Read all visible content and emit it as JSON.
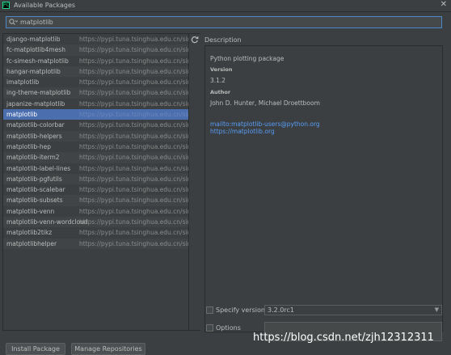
{
  "window": {
    "title": "Available Packages",
    "close_glyph": "✕",
    "app_icon_text": "PC"
  },
  "search": {
    "value": "matplotlib",
    "placeholder": ""
  },
  "packages": [
    {
      "name": "django-matplotlib",
      "url": "https://pypi.tuna.tsinghua.edu.cn/simple/"
    },
    {
      "name": "fc-matplotlib4mesh",
      "url": "https://pypi.tuna.tsinghua.edu.cn/simple/"
    },
    {
      "name": "fc-simesh-matplotlib",
      "url": "https://pypi.tuna.tsinghua.edu.cn/simple/"
    },
    {
      "name": "hangar-matplotlib",
      "url": "https://pypi.tuna.tsinghua.edu.cn/simple/"
    },
    {
      "name": "imatplotlib",
      "url": "https://pypi.tuna.tsinghua.edu.cn/simple/"
    },
    {
      "name": "ing-theme-matplotlib",
      "url": "https://pypi.tuna.tsinghua.edu.cn/simple/"
    },
    {
      "name": "japanize-matplotlib",
      "url": "https://pypi.tuna.tsinghua.edu.cn/simple/"
    },
    {
      "name": "matplotlib",
      "url": "https://pypi.tuna.tsinghua.edu.cn/simple/",
      "selected": true
    },
    {
      "name": "matplotlib-colorbar",
      "url": "https://pypi.tuna.tsinghua.edu.cn/simple/"
    },
    {
      "name": "matplotlib-helpers",
      "url": "https://pypi.tuna.tsinghua.edu.cn/simple/"
    },
    {
      "name": "matplotlib-hep",
      "url": "https://pypi.tuna.tsinghua.edu.cn/simple/"
    },
    {
      "name": "matplotlib-iterm2",
      "url": "https://pypi.tuna.tsinghua.edu.cn/simple/"
    },
    {
      "name": "matplotlib-label-lines",
      "url": "https://pypi.tuna.tsinghua.edu.cn/simple/"
    },
    {
      "name": "matplotlib-pgfutils",
      "url": "https://pypi.tuna.tsinghua.edu.cn/simple/"
    },
    {
      "name": "matplotlib-scalebar",
      "url": "https://pypi.tuna.tsinghua.edu.cn/simple/"
    },
    {
      "name": "matplotlib-subsets",
      "url": "https://pypi.tuna.tsinghua.edu.cn/simple/"
    },
    {
      "name": "matplotlib-venn",
      "url": "https://pypi.tuna.tsinghua.edu.cn/simple/"
    },
    {
      "name": "matplotlib-venn-wordcloud",
      "url": "https://pypi.tuna.tsinghua.edu.cn/simple/"
    },
    {
      "name": "matplotlib2tikz",
      "url": "https://pypi.tuna.tsinghua.edu.cn/simple/"
    },
    {
      "name": "matplotlibhelper",
      "url": "https://pypi.tuna.tsinghua.edu.cn/simple/"
    }
  ],
  "description": {
    "label": "Description",
    "summary": "Python plotting package",
    "version_heading": "Version",
    "version": "3.1.2",
    "author_heading": "Author",
    "author": "John D. Hunter, Michael Droettboom",
    "email_link": "mailto:matplotlib-users@python.org",
    "homepage_link": "https://matplotlib.org"
  },
  "options": {
    "specify_version_label": "Specify version",
    "specify_version_value": "3.2.0rc1",
    "options_label": "Options",
    "options_value": ""
  },
  "buttons": {
    "install": "Install Package",
    "manage": "Manage Repositories"
  },
  "icons": {
    "search": "magnifier-icon",
    "refresh": "refresh-icon",
    "chevron": "chevron-down-icon"
  },
  "watermark": "https://blog.csdn.net/zjh12312311",
  "colors": {
    "background": "#3c3f41",
    "selection": "#4b6eaf",
    "link": "#589df6",
    "focus_border": "#4a88c7"
  }
}
